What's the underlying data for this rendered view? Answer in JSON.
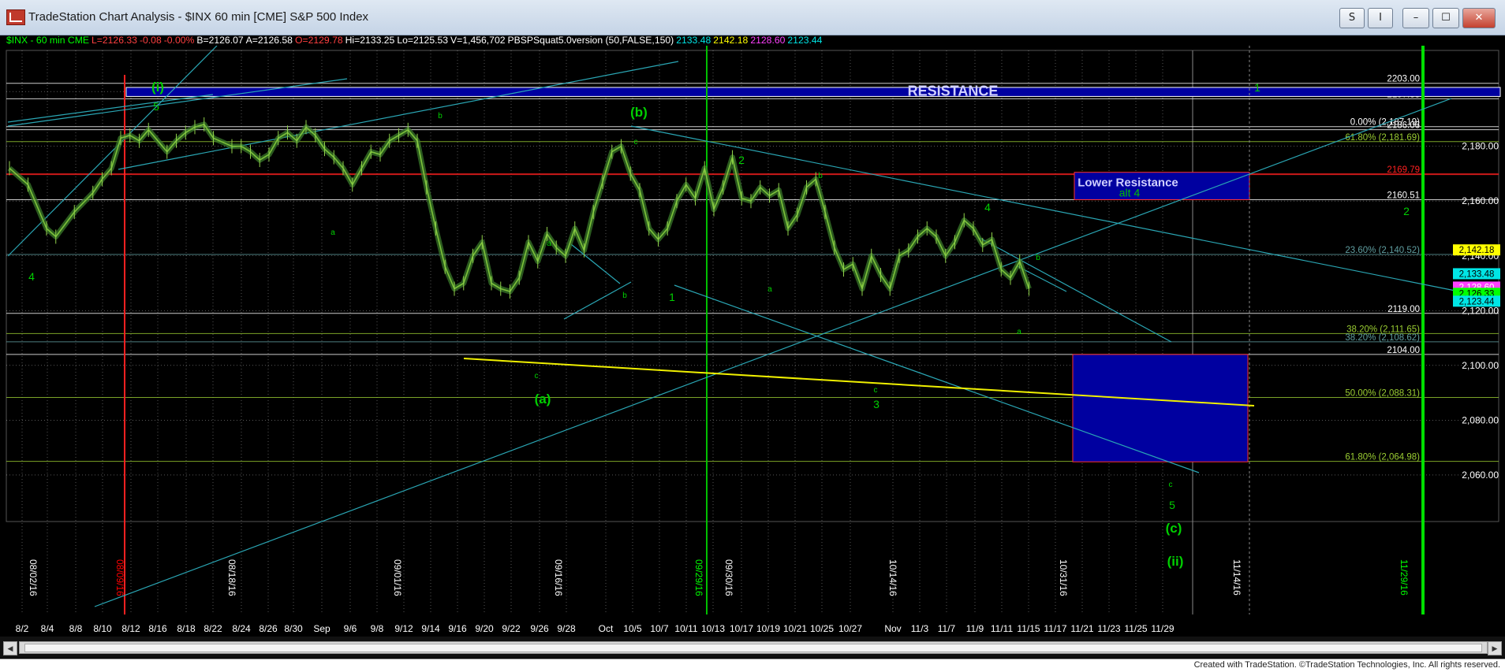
{
  "window": {
    "title": "TradeStation Chart Analysis - $INX 60 min [CME] S&P 500 Index",
    "buttons": [
      "S",
      "I",
      "–",
      "☐",
      "✕"
    ]
  },
  "infobar": [
    {
      "text": "$INX - 60 min  CME",
      "color": "#00ff00"
    },
    {
      "text": "L=2126.33",
      "color": "#ff4040"
    },
    {
      "text": "-0.08",
      "color": "#ff4040"
    },
    {
      "text": "-0.00%",
      "color": "#ff4040"
    },
    {
      "text": "B=2126.07",
      "color": "#ffffff"
    },
    {
      "text": "A=2126.58",
      "color": "#ffffff"
    },
    {
      "text": "O=2129.78",
      "color": "#ff4040"
    },
    {
      "text": "Hi=2133.25",
      "color": "#ffffff"
    },
    {
      "text": "Lo=2125.53",
      "color": "#ffffff"
    },
    {
      "text": "V=1,456,702",
      "color": "#ffffff"
    },
    {
      "text": "PBSPSquat5.0version (50,FALSE,150)",
      "color": "#ffffff"
    },
    {
      "text": "2133.48",
      "color": "#00e5e5"
    },
    {
      "text": "2142.18",
      "color": "#ffff00"
    },
    {
      "text": "2128.60",
      "color": "#ff40ff"
    },
    {
      "text": "2123.44",
      "color": "#00e5e5"
    }
  ],
  "credit": "Created with TradeStation. ©TradeStation Technologies, Inc. All rights reserved.",
  "chart_data": {
    "type": "candlestick",
    "ylim": [
      2043,
      2215
    ],
    "yticks": [
      "2,060.00",
      "2,080.00",
      "2,100.00",
      "2,120.00",
      "2,140.00",
      "2,160.00",
      "2,180.00",
      "2,200.00"
    ],
    "xticks": [
      "8/2",
      "8/4",
      "8/8",
      "8/10",
      "8/12",
      "8/16",
      "8/18",
      "8/22",
      "8/24",
      "8/26",
      "8/30",
      "Sep",
      "9/6",
      "9/8",
      "9/12",
      "9/14",
      "9/16",
      "9/20",
      "9/22",
      "9/26",
      "9/28",
      "Oct",
      "10/5",
      "10/7",
      "10/11",
      "10/13",
      "10/17",
      "10/19",
      "10/21",
      "10/25",
      "10/27",
      "Nov",
      "11/3",
      "11/7",
      "11/9",
      "11/11",
      "11/15",
      "11/17",
      "11/21",
      "11/23",
      "11/25",
      "11/29"
    ],
    "date_labels": [
      {
        "text": "08/02/16",
        "color": "#ffffff"
      },
      {
        "text": "08/09/16",
        "color": "#ff0000"
      },
      {
        "text": "08/18/16",
        "color": "#ffffff"
      },
      {
        "text": "09/01/16",
        "color": "#ffffff"
      },
      {
        "text": "09/16/16",
        "color": "#ffffff"
      },
      {
        "text": "09/29/16",
        "color": "#00ff00"
      },
      {
        "text": "09/30/16",
        "color": "#ffffff"
      },
      {
        "text": "10/14/16",
        "color": "#ffffff"
      },
      {
        "text": "10/31/16",
        "color": "#ffffff"
      },
      {
        "text": "11/14/16",
        "color": "#ffffff"
      },
      {
        "text": "11/29/16",
        "color": "#00ff00"
      }
    ],
    "price_path": [
      [
        0,
        2172
      ],
      [
        2,
        2166
      ],
      [
        4,
        2150
      ],
      [
        5,
        2147
      ],
      [
        7,
        2156
      ],
      [
        9,
        2163
      ],
      [
        10,
        2168
      ],
      [
        11,
        2172
      ],
      [
        12,
        2183
      ],
      [
        13,
        2184
      ],
      [
        14,
        2182
      ],
      [
        15,
        2186
      ],
      [
        17,
        2178
      ],
      [
        18,
        2182
      ],
      [
        19,
        2185
      ],
      [
        20,
        2187
      ],
      [
        21,
        2188
      ],
      [
        22,
        2183
      ],
      [
        24,
        2180
      ],
      [
        25,
        2180
      ],
      [
        26,
        2178
      ],
      [
        27,
        2175
      ],
      [
        28,
        2177
      ],
      [
        29,
        2183
      ],
      [
        30,
        2185
      ],
      [
        31,
        2182
      ],
      [
        32,
        2187
      ],
      [
        33,
        2184
      ],
      [
        34,
        2179
      ],
      [
        35,
        2176
      ],
      [
        36,
        2172
      ],
      [
        37,
        2166
      ],
      [
        38,
        2172
      ],
      [
        39,
        2178
      ],
      [
        40,
        2177
      ],
      [
        41,
        2182
      ],
      [
        42,
        2184
      ],
      [
        43,
        2186
      ],
      [
        44,
        2182
      ],
      [
        45,
        2165
      ],
      [
        46,
        2150
      ],
      [
        47,
        2136
      ],
      [
        48,
        2128
      ],
      [
        49,
        2130
      ],
      [
        50,
        2140
      ],
      [
        51,
        2145
      ],
      [
        52,
        2130
      ],
      [
        53,
        2128
      ],
      [
        54,
        2127
      ],
      [
        55,
        2132
      ],
      [
        56,
        2145
      ],
      [
        57,
        2138
      ],
      [
        58,
        2148
      ],
      [
        59,
        2143
      ],
      [
        60,
        2140
      ],
      [
        61,
        2150
      ],
      [
        62,
        2142
      ],
      [
        63,
        2156
      ],
      [
        64,
        2167
      ],
      [
        65,
        2178
      ],
      [
        66,
        2180
      ],
      [
        67,
        2170
      ],
      [
        68,
        2164
      ],
      [
        69,
        2150
      ],
      [
        70,
        2146
      ],
      [
        71,
        2150
      ],
      [
        72,
        2160
      ],
      [
        73,
        2166
      ],
      [
        74,
        2161
      ],
      [
        75,
        2172
      ],
      [
        76,
        2157
      ],
      [
        77,
        2165
      ],
      [
        78,
        2176
      ],
      [
        79,
        2161
      ],
      [
        80,
        2160
      ],
      [
        81,
        2165
      ],
      [
        82,
        2162
      ],
      [
        83,
        2164
      ],
      [
        84,
        2150
      ],
      [
        85,
        2155
      ],
      [
        86,
        2165
      ],
      [
        87,
        2168
      ],
      [
        88,
        2156
      ],
      [
        89,
        2143
      ],
      [
        90,
        2135
      ],
      [
        91,
        2137
      ],
      [
        92,
        2128
      ],
      [
        93,
        2140
      ],
      [
        94,
        2133
      ],
      [
        95,
        2128
      ],
      [
        96,
        2140
      ],
      [
        97,
        2142
      ],
      [
        98,
        2147
      ],
      [
        99,
        2150
      ],
      [
        100,
        2147
      ],
      [
        101,
        2140
      ],
      [
        102,
        2145
      ],
      [
        103,
        2153
      ],
      [
        104,
        2150
      ],
      [
        105,
        2144
      ],
      [
        106,
        2146
      ],
      [
        107,
        2135
      ],
      [
        108,
        2132
      ],
      [
        109,
        2138
      ],
      [
        110,
        2128
      ]
    ],
    "horizontal_lines": [
      {
        "price": 2203.0,
        "label": "2203.00",
        "color": "#ffffff"
      },
      {
        "price": 2197.33,
        "label": "2197.33",
        "color": "#ffffff"
      },
      {
        "price": 2187.19,
        "label": "0.00% (2,187.19)",
        "color": "#ffffff"
      },
      {
        "price": 2186.06,
        "label": "2186.06",
        "color": "#ffffff"
      },
      {
        "price": 2181.69,
        "label": "61.80% (2,181.69)",
        "color": "#9acd32"
      },
      {
        "price": 2169.79,
        "label": "2169.79",
        "color": "#ff2020"
      },
      {
        "price": 2160.51,
        "label": "2160.51",
        "color": "#ffffff"
      },
      {
        "price": 2140.52,
        "label": "23.60% (2,140.52)",
        "color": "#5f9ea0"
      },
      {
        "price": 2119.0,
        "label": "2119.00",
        "color": "#ffffff"
      },
      {
        "price": 2111.65,
        "label": "38.20% (2,111.65)",
        "color": "#9acd32"
      },
      {
        "price": 2108.62,
        "label": "38.20% (2,108.62)",
        "color": "#5f9ea0"
      },
      {
        "price": 2104.0,
        "label": "2104.00",
        "color": "#ffffff"
      },
      {
        "price": 2088.31,
        "label": "50.00% (2,088.31)",
        "color": "#9acd32"
      },
      {
        "price": 2064.98,
        "label": "61.80% (2,064.98)",
        "color": "#9acd32"
      }
    ],
    "price_tags": [
      {
        "label": "2,142.18",
        "price": 2142.18,
        "color": "#ffff00"
      },
      {
        "label": "2,133.48",
        "price": 2133.48,
        "color": "#00e5e5"
      },
      {
        "label": "2,128.60",
        "price": 2128.6,
        "color": "#ff40ff"
      },
      {
        "label": "2,126.33",
        "price": 2126.33,
        "color": "#00ff00"
      },
      {
        "label": "2,123.44",
        "price": 2123.44,
        "color": "#00e5e5"
      }
    ],
    "zones": [
      {
        "label": "RESISTANCE",
        "top": 2201.5,
        "bottom": 2198.2
      },
      {
        "label": "Lower Resistance",
        "sublabel": "alt 4",
        "top": 2170.5,
        "bottom": 2160.5
      },
      {
        "label": "",
        "top": 2104.0,
        "bottom": 2064.8
      }
    ],
    "wave_labels": [
      "(i)",
      "5",
      "4",
      "a",
      "b",
      "(b)",
      "c",
      "(a)",
      "a",
      "b",
      "c",
      "1",
      "2",
      "a",
      "b",
      "c",
      "3",
      "4",
      "b",
      "a",
      "1",
      "2",
      "c",
      "5",
      "(c)",
      "(ii)"
    ]
  }
}
